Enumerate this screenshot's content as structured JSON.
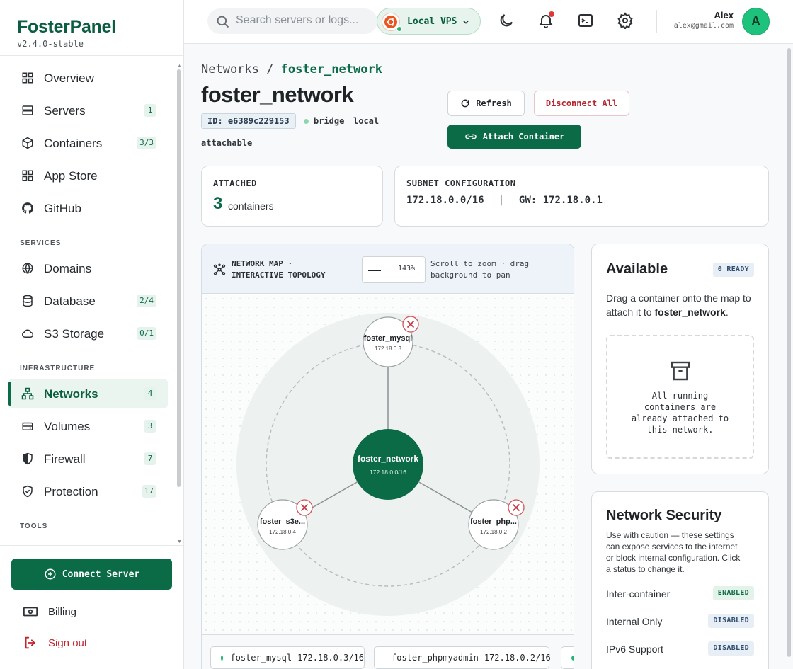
{
  "brand": {
    "name": "FosterPanel",
    "version": "v2.4.0-stable"
  },
  "sidebar": {
    "items": [
      {
        "label": "Overview",
        "badge": ""
      },
      {
        "label": "Servers",
        "badge": "1"
      },
      {
        "label": "Containers",
        "badge": "3/3"
      },
      {
        "label": "App Store",
        "badge": ""
      },
      {
        "label": "GitHub",
        "badge": ""
      }
    ],
    "services_heading": "SERVICES",
    "services": [
      {
        "label": "Domains",
        "badge": ""
      },
      {
        "label": "Database",
        "badge": "2/4"
      },
      {
        "label": "S3 Storage",
        "badge": "0/1"
      }
    ],
    "infra_heading": "INFRASTRUCTURE",
    "infra": [
      {
        "label": "Networks",
        "badge": "4"
      },
      {
        "label": "Volumes",
        "badge": "3"
      },
      {
        "label": "Firewall",
        "badge": "7"
      },
      {
        "label": "Protection",
        "badge": "17"
      }
    ],
    "tools_heading": "TOOLS",
    "connect_label": "Connect Server",
    "billing_label": "Billing",
    "signout_label": "Sign out"
  },
  "topbar": {
    "search_placeholder": "Search servers or logs...",
    "server_name": "Local VPS",
    "user_name": "Alex",
    "user_email": "alex@gmail.com",
    "avatar_initial": "A"
  },
  "page": {
    "crumb_root": "Networks",
    "crumb_sep": "/",
    "crumb_current": "foster_network",
    "title": "foster_network",
    "id_label": "ID: e6389c229153",
    "driver": "bridge",
    "scope": "local",
    "attachable": "attachable",
    "refresh_label": "Refresh",
    "disconnect_label": "Disconnect All",
    "attach_label": "Attach Container"
  },
  "stats": {
    "attached_heading": "ATTACHED",
    "attached_count": "3",
    "attached_unit": "containers",
    "subnet_heading": "SUBNET CONFIGURATION",
    "subnet": "172.18.0.0/16",
    "sep": "|",
    "gateway": "GW: 172.18.0.1"
  },
  "map": {
    "title_line1": "NETWORK MAP ·",
    "title_line2": "INTERACTIVE TOPOLOGY",
    "zoom_value": "143%",
    "hint_line1": "Scroll to zoom · drag",
    "hint_line2": "background to pan",
    "center": {
      "name": "foster_network",
      "ip": "172.18.0.0/16"
    },
    "nodes": [
      {
        "name": "foster_mysql",
        "ip": "172.18.0.3"
      },
      {
        "name": "foster_s3e...",
        "ip": "172.18.0.4"
      },
      {
        "name": "foster_php...",
        "ip": "172.18.0.2"
      }
    ],
    "chips": [
      {
        "name": "foster_mysql",
        "ip": "172.18.0.3/16"
      },
      {
        "name": "foster_phpmyadmin",
        "ip": "172.18.0.2/16"
      }
    ]
  },
  "available": {
    "title": "Available",
    "badge": "0 READY",
    "desc_pre": "Drag a container onto the map to attach it to ",
    "desc_net": "foster_network",
    "desc_post": ".",
    "empty_line1": "All running",
    "empty_line2": "containers are",
    "empty_line3": "already attached to",
    "empty_line4": "this network."
  },
  "security": {
    "title": "Network Security",
    "desc_line1": "Use with caution — these settings",
    "desc_line2": "can expose services to the internet",
    "desc_line3": "or block internal configuration. Click",
    "desc_line4": "a status to change it.",
    "rows": [
      {
        "label": "Inter-container",
        "status": "ENABLED"
      },
      {
        "label": "Internal Only",
        "status": "DISABLED"
      },
      {
        "label": "IPv6 Support",
        "status": "DISABLED"
      }
    ]
  },
  "colors": {
    "accent": "#0b6b47",
    "danger": "#b3262f",
    "enabled_bg": "#e3f3ea",
    "disabled_bg": "#e8eef6"
  }
}
